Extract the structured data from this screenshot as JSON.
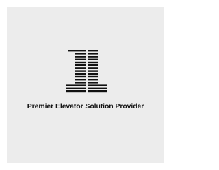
{
  "brand": {
    "logo_icon": "jl-striped-monogram-logo",
    "logo_letters": "JL",
    "tagline": "Premier Elevator Solution Provider",
    "logo_color": "#111111",
    "background_color": "#ececec"
  }
}
